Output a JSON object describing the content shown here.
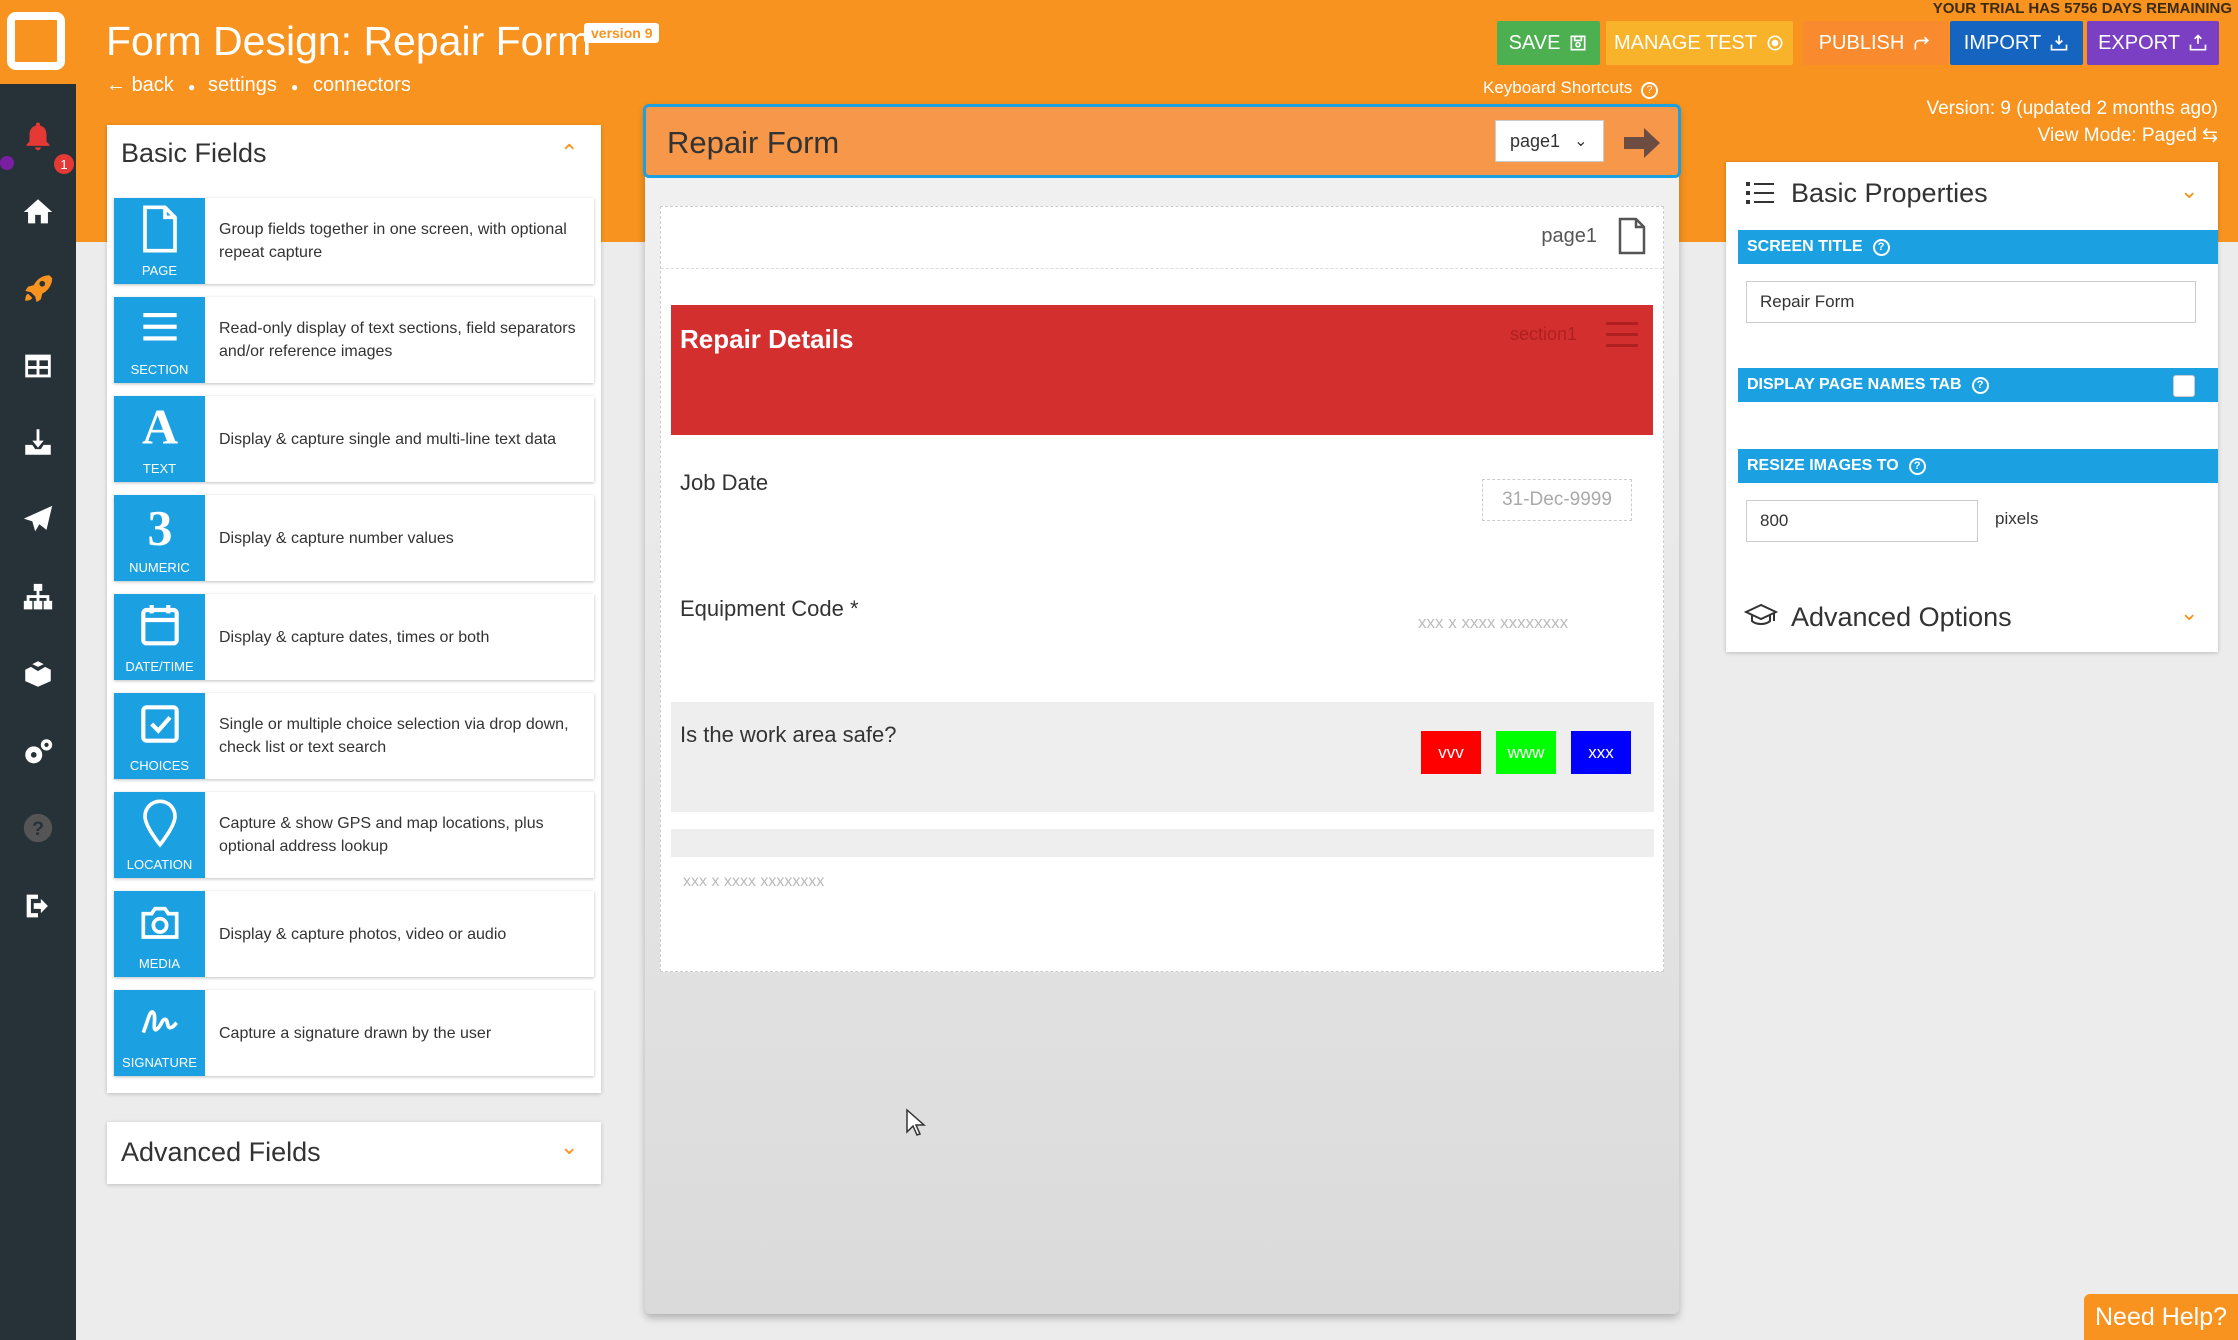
{
  "app": {
    "trial_text": "YOUR TRIAL HAS 5756 DAYS REMAINING"
  },
  "header": {
    "title": "Form Design: Repair Form",
    "version_badge": "version 9",
    "breadcrumb": [
      "back",
      "settings",
      "connectors"
    ],
    "buttons": {
      "save": "SAVE",
      "manage_test": "MANAGE TEST",
      "publish": "PUBLISH",
      "import": "IMPORT",
      "export": "EXPORT"
    },
    "keyboard_shortcuts": "Keyboard Shortcuts",
    "version_info": "Version: 9 (updated 2 months ago)",
    "view_mode": "View Mode: Paged"
  },
  "sidebar": {
    "icons": [
      "bell-icon",
      "home-icon",
      "rocket-icon",
      "grid-icon",
      "download-icon",
      "send-icon",
      "sitemap-icon",
      "boxes-icon",
      "gears-icon",
      "help-icon",
      "logout-icon"
    ],
    "notification_count": "1"
  },
  "basic_fields": {
    "title": "Basic Fields",
    "items": [
      {
        "label": "PAGE",
        "icon": "page-icon",
        "desc": "Group fields together in one screen, with optional repeat capture"
      },
      {
        "label": "SECTION",
        "icon": "section-icon",
        "desc": "Read-only display of text sections, field separators and/or reference images"
      },
      {
        "label": "TEXT",
        "icon": "text-icon",
        "desc": "Display & capture single and multi-line text data"
      },
      {
        "label": "NUMERIC",
        "icon": "numeric-icon",
        "desc": "Display & capture number values"
      },
      {
        "label": "DATE/TIME",
        "icon": "calendar-icon",
        "desc": "Display & capture dates, times or both"
      },
      {
        "label": "CHOICES",
        "icon": "checkbox-icon",
        "desc": "Single or multiple choice selection via drop down, check list or text search"
      },
      {
        "label": "LOCATION",
        "icon": "location-pin-icon",
        "desc": "Capture & show GPS and map locations, plus optional address lookup"
      },
      {
        "label": "MEDIA",
        "icon": "camera-icon",
        "desc": "Display & capture photos, video or audio"
      },
      {
        "label": "SIGNATURE",
        "icon": "signature-icon",
        "desc": "Capture a signature drawn by the user"
      }
    ]
  },
  "advanced_fields": {
    "title": "Advanced Fields"
  },
  "form": {
    "title": "Repair Form",
    "page_select": "page1",
    "page_name": "page1",
    "section_title": "Repair Details",
    "section_id": "section1",
    "job_date_label": "Job Date",
    "job_date_placeholder": "31-Dec-9999",
    "equipment_label": "Equipment Code *",
    "equipment_placeholder": "xxx x xxxx xxxxxxxx",
    "safe_label": "Is the work area safe?",
    "choices": [
      {
        "label": "vvv",
        "color": "#ff0000"
      },
      {
        "label": "www",
        "color": "#00ff00"
      },
      {
        "label": "xxx",
        "color": "#0000ff"
      }
    ],
    "extra_placeholder": "xxx x xxxx xxxxxxxx"
  },
  "properties": {
    "title": "Basic Properties",
    "screen_title_label": "SCREEN TITLE",
    "screen_title_value": "Repair Form",
    "page_names_tab_label": "DISPLAY PAGE NAMES TAB",
    "resize_label": "RESIZE IMAGES TO",
    "resize_value": "800",
    "resize_unit": "pixels",
    "advanced_options": "Advanced Options"
  },
  "help": {
    "label": "Need Help?"
  },
  "colors": {
    "brand_orange": "#f7931e",
    "accent_blue": "#1ba1e2",
    "sidebar": "#263238",
    "section_red": "#d32f2f"
  }
}
